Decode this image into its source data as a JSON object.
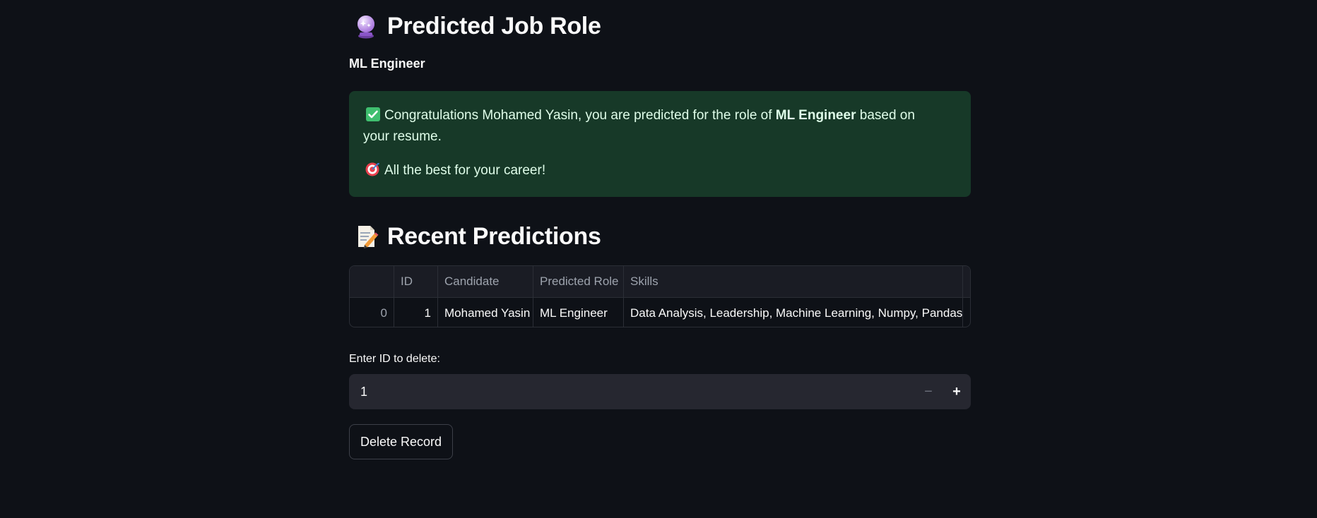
{
  "prediction": {
    "heading": "Predicted Job Role",
    "heading_icon": "crystal-ball-icon",
    "role": "ML Engineer"
  },
  "success": {
    "text_before": "Congratulations Mohamed Yasin, you are predicted for the role of ",
    "role_bold": "ML Engineer",
    "text_after": " based on your resume.",
    "wish": "All the best for your career!",
    "colors": {
      "background": "#173928",
      "text": "#dffde9"
    }
  },
  "recent": {
    "heading": "Recent Predictions",
    "heading_icon": "memo-icon",
    "columns": [
      "",
      "ID",
      "Candidate",
      "Predicted Role",
      "Skills"
    ],
    "rows": [
      {
        "index": "0",
        "id": "1",
        "candidate": "Mohamed Yasin",
        "role": "ML Engineer",
        "skills": "Data Analysis, Leadership, Machine Learning, Numpy, Pandas, Po"
      }
    ]
  },
  "delete": {
    "label": "Enter ID to delete:",
    "value": "1",
    "minus": "−",
    "plus": "+",
    "button_label": "Delete Record"
  }
}
